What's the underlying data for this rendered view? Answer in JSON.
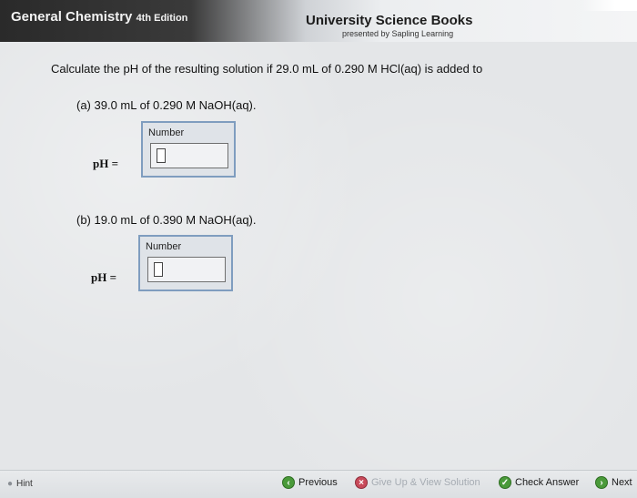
{
  "header": {
    "book_title": "General Chemistry",
    "edition": "4th Edition",
    "publisher": "University Science Books",
    "tagline": "presented by Sapling Learning"
  },
  "question": {
    "prompt": "Calculate the pH of the resulting solution if 29.0 mL of 0.290 M HCl(aq) is added to",
    "parts": [
      {
        "label": "(a) 39.0 mL of 0.290 M NaOH(aq).",
        "input_label": "Number",
        "ph_label": "pH =",
        "value": ""
      },
      {
        "label": "(b) 19.0 mL of 0.390 M NaOH(aq).",
        "input_label": "Number",
        "ph_label": "pH =",
        "value": ""
      }
    ]
  },
  "footer": {
    "hint": "Hint",
    "previous": "Previous",
    "give_up": "Give Up & View Solution",
    "check_answer": "Check Answer",
    "next": "Next"
  },
  "colors": {
    "header_dark": "#2a2a2a",
    "box_border": "#7f9dbf",
    "green_icon": "#4a9a3a",
    "red_icon": "#c84a5a"
  }
}
